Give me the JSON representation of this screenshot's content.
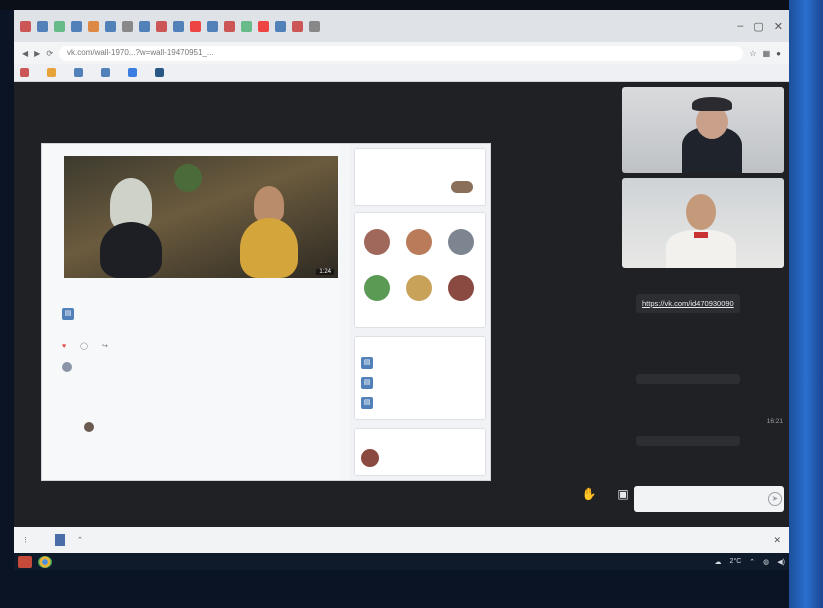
{
  "colors": {
    "accent_blue": "#1a73e8",
    "vk_blue": "#5181b8",
    "meet_dark": "#202124",
    "like_red": "#e64646"
  },
  "browser": {
    "address_url": "vk.com/wall-1970...?w=wall-19470951_...",
    "tab_icons": [
      "tab-icon",
      "tab-icon",
      "tab-icon",
      "tab-icon",
      "tab-icon",
      "tab-icon",
      "tab-icon",
      "tab-icon",
      "tab-icon",
      "tab-icon",
      "tab-icon",
      "tab-icon",
      "tab-icon",
      "tab-icon",
      "tab-icon",
      "tab-icon",
      "tab-icon",
      "tab-icon"
    ],
    "bookmarks": [
      "",
      "",
      "",
      "",
      "",
      ""
    ]
  },
  "shared": {
    "video_duration": "1:24",
    "post_title": "",
    "post_subtitle": "",
    "attachment": "",
    "likes": "",
    "comments": "",
    "views": "",
    "comment1_author": "",
    "comment1_text": "",
    "comment1_meta": "",
    "comment2_author": "",
    "comment2_text": "",
    "comment2_meta": "",
    "side_top": "",
    "friends_title": "",
    "friends": [
      "",
      "",
      "",
      "",
      "",
      ""
    ],
    "docs_title": "",
    "docs": [
      "",
      "",
      ""
    ],
    "members_title": "",
    "member": ""
  },
  "chat": {
    "messages": [
      {
        "author": "",
        "text": "https://vk.com/id470930090",
        "time": ""
      },
      {
        "author": "",
        "text": "",
        "time": ""
      },
      {
        "author": "",
        "text": "",
        "time": "16:21"
      }
    ],
    "input_placeholder": ""
  },
  "downloads": {
    "file_label": "",
    "show_all": "",
    "close_glyph": "✕"
  },
  "taskbar": {
    "weather": "2°C"
  }
}
